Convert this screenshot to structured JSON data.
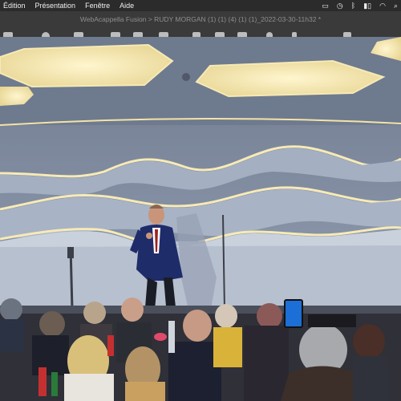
{
  "menubar": {
    "items": [
      "Édition",
      "Présentation",
      "Fenêtre",
      "Aide"
    ],
    "status_icons": [
      "screen-mirroring-icon",
      "time-machine-icon",
      "bluetooth-icon",
      "battery-icon",
      "wifi-icon",
      "search-icon"
    ]
  },
  "window": {
    "title": "WebAcappella Fusion > RUDY MORGAN (1) (1) (4) (1) (1)_2022-03-30-11h32 *"
  },
  "toolbar": {
    "buttons": [
      "file-icon",
      "record-icon",
      "mixer-icon",
      "clip-icon",
      "layout-icon",
      "screen-icon",
      "track-icon",
      "list-icon",
      "grid-icon",
      "zoom-icon",
      "more-icon",
      "settings-icon"
    ]
  },
  "video": {
    "scene": "singer on stage performing in front of seated audience",
    "colors": {
      "wall": "#8f9db3",
      "ceiling": "#6d7789",
      "light": "#f3e3a8",
      "stage": "#c8cfd9"
    }
  }
}
